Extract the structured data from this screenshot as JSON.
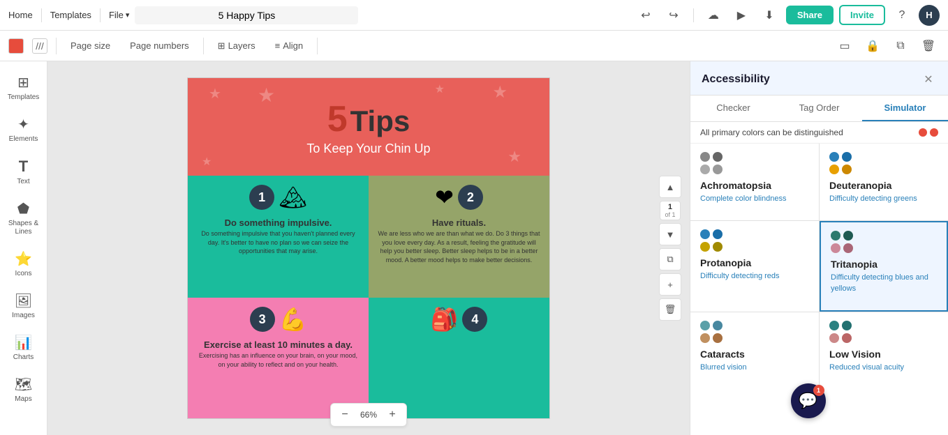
{
  "app": {
    "home": "Home",
    "templates": "Templates",
    "file": "File",
    "file_chevron": "▾",
    "title": "5 Happy Tips",
    "undo": "↩",
    "redo": "↪",
    "cloud_icon": "☁",
    "present_icon": "▶",
    "download_icon": "⬇",
    "share_label": "Share",
    "invite_label": "Invite",
    "help_icon": "?",
    "avatar_initial": "H"
  },
  "toolbar": {
    "color_label": "Color",
    "pattern_label": "///",
    "page_size_label": "Page size",
    "page_numbers_label": "Page numbers",
    "layers_label": "Layers",
    "align_label": "Align",
    "layers_icon": "⊞",
    "align_icon": "≡",
    "frame_icon": "▭",
    "lock_icon": "🔒",
    "copy_icon": "⧉",
    "delete_icon": "🗑"
  },
  "sidebar": {
    "items": [
      {
        "id": "templates",
        "label": "Templates",
        "icon": "⊞"
      },
      {
        "id": "elements",
        "label": "Elements",
        "icon": "✦"
      },
      {
        "id": "text",
        "label": "Text",
        "icon": "T"
      },
      {
        "id": "shapes",
        "label": "Shapes & Lines",
        "icon": "⬟"
      },
      {
        "id": "icons",
        "label": "Icons",
        "icon": "⭐"
      },
      {
        "id": "images",
        "label": "Images",
        "icon": "🖼"
      },
      {
        "id": "charts",
        "label": "Charts",
        "icon": "📊"
      },
      {
        "id": "maps",
        "label": "Maps",
        "icon": "🗺"
      }
    ]
  },
  "canvas": {
    "page_current": "1",
    "page_total": "of 1",
    "zoom": "66%"
  },
  "infographic": {
    "title_number": "5",
    "title_text": "Tips",
    "subtitle": "To Keep Your Chin Up",
    "tip1_num": "1",
    "tip1_heading": "Do something impulsive.",
    "tip1_body": "Do something impulsive that you haven't planned every day. It's better to have no plan so we can seize the opportunities that may arise.",
    "tip2_num": "2",
    "tip2_heading": "Have rituals.",
    "tip2_body": "We are less who we are than what we do. Do 3 things that you love every day. As a result, feeling the gratitude will help you better sleep. Better sleep helps to be in a better mood. A better mood helps to make better decisions.",
    "tip3_num": "3",
    "tip3_heading": "Exercise at least 10 minutes a day.",
    "tip3_body": "Exercising has an influence on your brain, on your mood, on your ability to reflect and on your health.",
    "tip4_num": "4"
  },
  "accessibility_panel": {
    "title": "Accessibility",
    "close_icon": "✕",
    "tabs": [
      {
        "id": "checker",
        "label": "Checker"
      },
      {
        "id": "tag-order",
        "label": "Tag Order"
      },
      {
        "id": "simulator",
        "label": "Simulator"
      }
    ],
    "active_tab": "simulator",
    "status_text": "All primary colors can be distinguished",
    "status_dots": [
      {
        "color": "#e74c3c"
      },
      {
        "color": "#e74c3c"
      }
    ],
    "vision_types": [
      {
        "id": "achromatopsia",
        "title": "Achromatopsia",
        "desc": "Complete color blindness",
        "active": false,
        "dots": [
          "#888",
          "#666",
          "#aaa",
          "#999"
        ]
      },
      {
        "id": "deuteranopia",
        "title": "Deuteranopia",
        "desc": "Difficulty detecting greens",
        "active": false,
        "dots": [
          "#2980b9",
          "#1a6ea8",
          "#e8a000",
          "#cc8800"
        ]
      },
      {
        "id": "protanopia",
        "title": "Protanopia",
        "desc": "Difficulty detecting reds",
        "active": false,
        "dots": [
          "#2980b9",
          "#1a6ea8",
          "#c4a200",
          "#a08a00"
        ]
      },
      {
        "id": "tritanopia",
        "title": "Tritanopia",
        "desc": "Difficulty detecting blues and yellows",
        "active": true,
        "dots": [
          "#2d7a6e",
          "#1f5a52",
          "#cc8899",
          "#aa6677"
        ]
      },
      {
        "id": "cataracts",
        "title": "Cataracts",
        "desc": "Blurred vision",
        "active": false,
        "dots": [
          "#5ba0a8",
          "#4888a0",
          "#c09060",
          "#a87040"
        ]
      },
      {
        "id": "low-vision",
        "title": "Low Vision",
        "desc": "Reduced visual acuity",
        "active": false,
        "dots": [
          "#2a8080",
          "#227070",
          "#cc8888",
          "#bb6666"
        ]
      }
    ]
  },
  "chat": {
    "icon": "💬",
    "badge_count": "1"
  }
}
